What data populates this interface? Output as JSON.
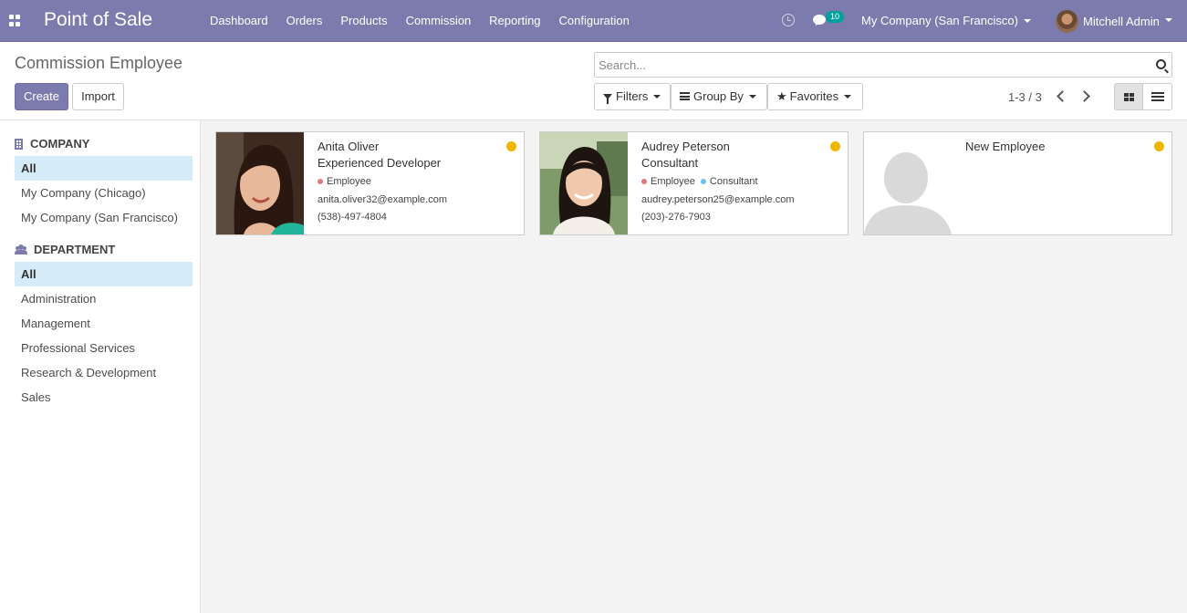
{
  "navbar": {
    "brand": "Point of Sale",
    "menu": [
      "Dashboard",
      "Orders",
      "Products",
      "Commission",
      "Reporting",
      "Configuration"
    ],
    "chat_count": "10",
    "company": "My Company (San Francisco)",
    "user": "Mitchell Admin",
    "color": "#7c7bad"
  },
  "control": {
    "title": "Commission Employee",
    "create_label": "Create",
    "import_label": "Import",
    "search_placeholder": "Search...",
    "filters_label": "Filters",
    "groupby_label": "Group By",
    "favorites_label": "Favorites",
    "pager": "1-3 / 3"
  },
  "sidebar": {
    "company_heading": "COMPANY",
    "company_items": [
      "All",
      "My Company (Chicago)",
      "My Company (San Francisco)"
    ],
    "department_heading": "DEPARTMENT",
    "department_items": [
      "All",
      "Administration",
      "Management",
      "Professional Services",
      "Research & Development",
      "Sales"
    ]
  },
  "cards": [
    {
      "name": "Anita Oliver",
      "job": "Experienced Developer",
      "tags": [
        {
          "label": "Employee",
          "color": "#e07a7a"
        }
      ],
      "email": "anita.oliver32@example.com",
      "phone": "(538)-497-4804",
      "status_color": "#f0b500"
    },
    {
      "name": "Audrey Peterson",
      "job": "Consultant",
      "tags": [
        {
          "label": "Employee",
          "color": "#e07a7a"
        },
        {
          "label": "Consultant",
          "color": "#6cc1ed"
        }
      ],
      "email": "audrey.peterson25@example.com",
      "phone": "(203)-276-7903",
      "status_color": "#f0b500"
    },
    {
      "name": "New Employee",
      "status_color": "#f0b500"
    }
  ]
}
